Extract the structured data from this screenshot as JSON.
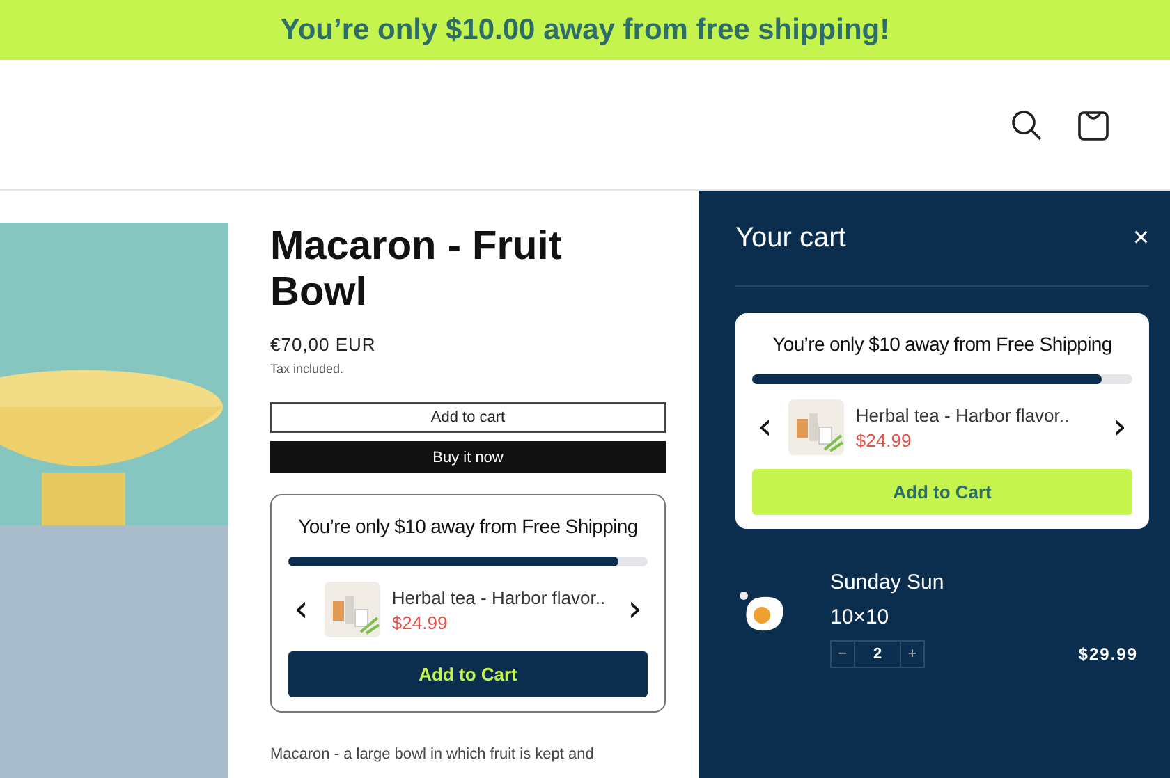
{
  "announcement": {
    "text": "You’re only $10.00 away from free shipping!"
  },
  "product": {
    "title": "Macaron - Fruit Bowl",
    "price": "€70,00 EUR",
    "tax_note": "Tax included.",
    "add_to_cart": "Add to cart",
    "buy_now": "Buy it now",
    "description": "Macaron - a large bowl in which fruit is kept and"
  },
  "upsells": [
    {
      "kind": "dark",
      "heading": "You’re only $10 away from Free Shipping",
      "level": 0.92,
      "prev": "‹",
      "next": "›",
      "item_name": "Herbal tea - Harbor flavor..",
      "item_price": "$24.99",
      "button": "Add to Cart"
    },
    {
      "kind": "lime",
      "heading": "You’re only $10 away from Free Shipping",
      "level": 0.92,
      "prev": "‹",
      "next": "›",
      "item_name": "Herbal tea - Harbor flavor..",
      "item_price": "$24.99",
      "button": "Add to Cart"
    }
  ],
  "cart": {
    "title": "Your cart",
    "close": "×",
    "items": [
      {
        "name": "Sunday Sun",
        "variant": "10×10",
        "minus": "−",
        "quantity": "2",
        "plus": "+",
        "price": "$29.99"
      }
    ]
  }
}
